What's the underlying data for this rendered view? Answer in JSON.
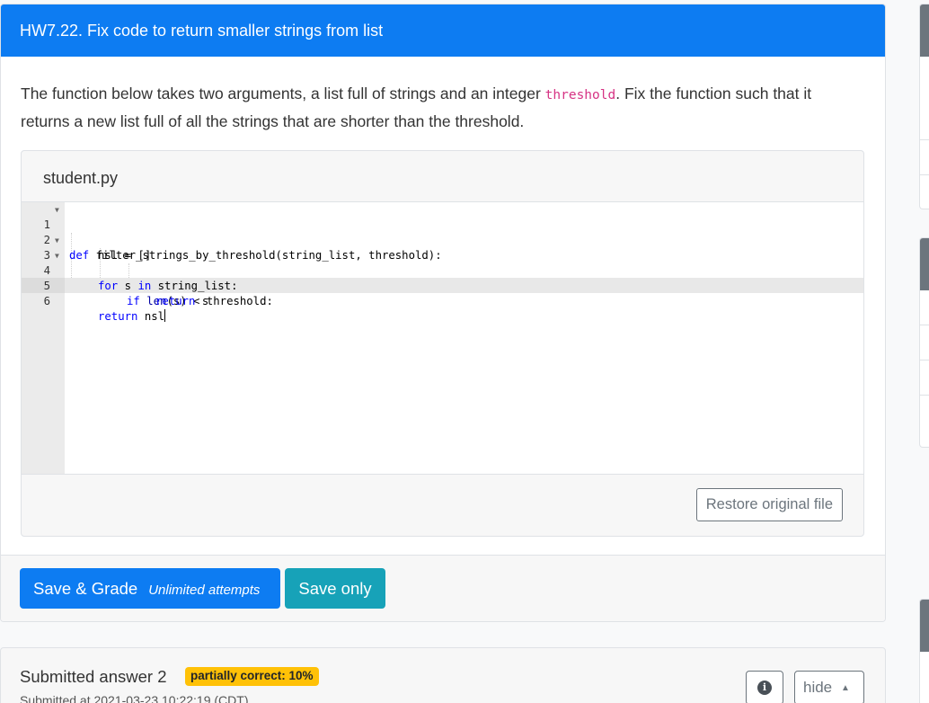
{
  "question": {
    "title": "HW7.22. Fix code to return smaller strings from list",
    "prompt_before": "The function below takes two arguments, a list full of strings and an integer ",
    "prompt_code": "threshold",
    "prompt_after": ". Fix the function such that it returns a new list full of all the strings that are shorter than the threshold."
  },
  "file": {
    "name": "student.py",
    "line_numbers": [
      "1",
      "2",
      "3",
      "4",
      "5",
      "6"
    ],
    "restore_label": "Restore original file"
  },
  "code": {
    "l1_kw": "def",
    "l1_rest": " filter_strings_by_threshold(string_list, threshold):",
    "l2": "nsl = []",
    "l3_kw1": "for",
    "l3_mid": " s ",
    "l3_kw2": "in",
    "l3_rest": " string_list:",
    "l4_kw": "if",
    "l4_fn": "len",
    "l4_rest": "(s) < threshold:",
    "l5_kw": "return",
    "l5_rest": " s",
    "l6_kw": "return",
    "l6_rest": " nsl"
  },
  "actions": {
    "grade_label": "Save & Grade",
    "grade_sub": "Unlimited attempts",
    "save_label": "Save only"
  },
  "submission": {
    "title": "Submitted answer 2",
    "badge": "partially correct: 10%",
    "time": "Submitted at 2021-03-23 10:22:19 (CDT)",
    "hide_label": "hide"
  },
  "colors": {
    "primary": "#0d7cf2",
    "info": "#17a2b8",
    "warning": "#ffc107",
    "secondary": "#6c757d"
  }
}
